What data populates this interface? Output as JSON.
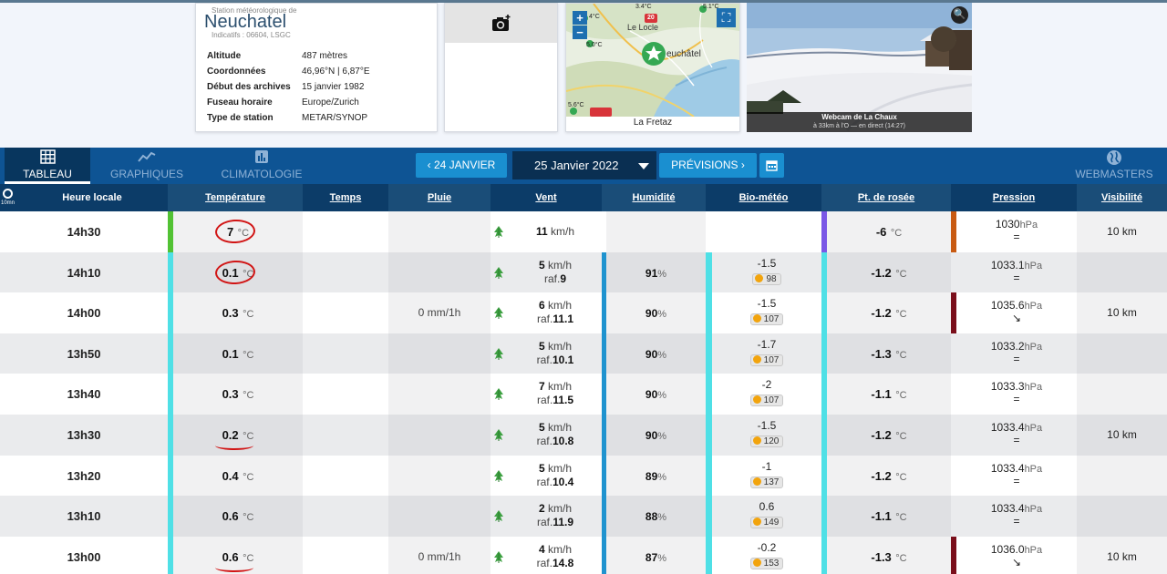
{
  "station": {
    "kicker": "Station météorologique de",
    "name": "Neuchatel",
    "ids": "Indicatifs : 06604, LSGC",
    "rows": [
      {
        "label": "Altitude",
        "value": "487 mètres"
      },
      {
        "label": "Coordonnées",
        "value": "46,96°N | 6,87°E"
      },
      {
        "label": "Début des archives",
        "value": "15 janvier 1982"
      },
      {
        "label": "Fuseau horaire",
        "value": "Europe/Zurich"
      },
      {
        "label": "Type de station",
        "value": "METAR/SYNOP"
      }
    ]
  },
  "map": {
    "caption": "La Fretaz",
    "labels": {
      "city1": "Le Locle",
      "city2": "euchâtel",
      "road": "20",
      "t1": "4°C",
      "t2": "5.0°C",
      "t3": "5.6°C",
      "t4": "5.1°C",
      "t5": "3.4°C"
    },
    "zoom_in": "+",
    "zoom_out": "−"
  },
  "webcam": {
    "title": "Webcam de La Chaux",
    "subtitle": "à 33km à l'O — en direct (14:27)"
  },
  "nav": {
    "tabs": [
      {
        "label": "TABLEAU",
        "icon": "grid-icon",
        "active": true
      },
      {
        "label": "GRAPHIQUES",
        "icon": "chart-line-icon",
        "active": false
      },
      {
        "label": "CLIMATOLOGIE",
        "icon": "bar-chart-icon",
        "active": false
      }
    ],
    "prev_label": "‹ 24 JANVIER",
    "date_label": "25 Janvier 2022",
    "next_label": "PRÉVISIONS ›",
    "webmasters_label": "WEBMASTERS"
  },
  "table": {
    "clock_sub": "10mn",
    "headers": [
      "Heure locale",
      "Température",
      "Temps",
      "Pluie",
      "Vent",
      "Humidité",
      "Bio-météo",
      "Pt. de rosée",
      "Pression",
      "Visibilité"
    ],
    "units": {
      "temp": "°C",
      "wind": "km/h",
      "gust": "raf.",
      "hum": "%",
      "rain": "mm/1h",
      "pres": "hPa",
      "vis": "km"
    },
    "rows": [
      {
        "time": "14h30",
        "temp": "7",
        "rain": "",
        "wind": "11",
        "gust": "",
        "hum": "",
        "bio": "",
        "bio_idx": "",
        "dew": "-6",
        "pres": "1030",
        "trend": "=",
        "vis": "10"
      },
      {
        "time": "14h10",
        "temp": "0.1",
        "rain": "",
        "wind": "5",
        "gust": "9",
        "hum": "91",
        "bio": "-1.5",
        "bio_idx": "98",
        "dew": "-1.2",
        "pres": "1033.1",
        "trend": "=",
        "vis": ""
      },
      {
        "time": "14h00",
        "temp": "0.3",
        "rain": "0",
        "wind": "6",
        "gust": "11.1",
        "hum": "90",
        "bio": "-1.5",
        "bio_idx": "107",
        "dew": "-1.2",
        "pres": "1035.6",
        "trend": "↘",
        "vis": "10"
      },
      {
        "time": "13h50",
        "temp": "0.1",
        "rain": "",
        "wind": "5",
        "gust": "10.1",
        "hum": "90",
        "bio": "-1.7",
        "bio_idx": "107",
        "dew": "-1.3",
        "pres": "1033.2",
        "trend": "=",
        "vis": ""
      },
      {
        "time": "13h40",
        "temp": "0.3",
        "rain": "",
        "wind": "7",
        "gust": "11.5",
        "hum": "90",
        "bio": "-2",
        "bio_idx": "107",
        "dew": "-1.1",
        "pres": "1033.3",
        "trend": "=",
        "vis": ""
      },
      {
        "time": "13h30",
        "temp": "0.2",
        "rain": "",
        "wind": "5",
        "gust": "10.8",
        "hum": "90",
        "bio": "-1.5",
        "bio_idx": "120",
        "dew": "-1.2",
        "pres": "1033.4",
        "trend": "=",
        "vis": "10"
      },
      {
        "time": "13h20",
        "temp": "0.4",
        "rain": "",
        "wind": "5",
        "gust": "10.4",
        "hum": "89",
        "bio": "-1",
        "bio_idx": "137",
        "dew": "-1.2",
        "pres": "1033.4",
        "trend": "=",
        "vis": ""
      },
      {
        "time": "13h10",
        "temp": "0.6",
        "rain": "",
        "wind": "2",
        "gust": "11.9",
        "hum": "88",
        "bio": "0.6",
        "bio_idx": "149",
        "dew": "-1.1",
        "pres": "1033.4",
        "trend": "=",
        "vis": ""
      },
      {
        "time": "13h00",
        "temp": "0.6",
        "rain": "0",
        "wind": "4",
        "gust": "14.8",
        "hum": "87",
        "bio": "-0.2",
        "bio_idx": "153",
        "dew": "-1.3",
        "pres": "1036.0",
        "trend": "↘",
        "vis": "10"
      }
    ]
  },
  "colors": {
    "nav_bg": "#0e5494",
    "header_bg": "#0c3c68",
    "annotation_red": "#d11515",
    "temp_bar_first": "#52c234",
    "temp_bar": "#4fe0e6",
    "dew_bar_first": "#7a57e6",
    "pres_bar_first": "#c85a12",
    "pres_bar": "#7a0f1b",
    "hum_bar": "#1f93cf"
  }
}
